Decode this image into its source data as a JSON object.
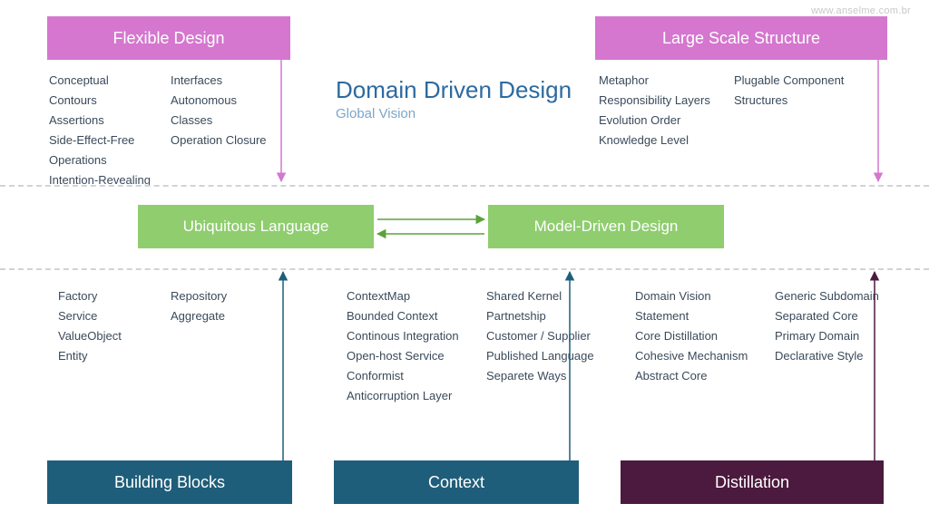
{
  "watermark": "www.anselme.com.br",
  "title": {
    "main": "Domain Driven Design",
    "sub": "Global Vision"
  },
  "top": {
    "flexible": {
      "header": "Flexible Design",
      "col1": [
        "Conceptual Contours",
        "Assertions",
        "Side-Effect-Free",
        "Operations",
        "Intention-Revealing"
      ],
      "col2": [
        "Interfaces",
        "Autonomous Classes",
        "Operation Closure"
      ]
    },
    "large": {
      "header": "Large Scale Structure",
      "col1": [
        "Metaphor",
        "Responsibility Layers",
        "Evolution Order",
        "Knowledge Level"
      ],
      "col2": [
        "Plugable Component",
        "Structures"
      ]
    }
  },
  "middle": {
    "left": "Ubiquitous Language",
    "right": "Model-Driven Design"
  },
  "bottom": {
    "building": {
      "header": "Building Blocks",
      "col1": [
        "Factory",
        "Service",
        "ValueObject",
        "Entity"
      ],
      "col2": [
        "Repository",
        "Aggregate"
      ]
    },
    "context": {
      "header": "Context",
      "col1": [
        "ContextMap",
        "Bounded Context",
        "Continous Integration",
        "Open-host Service",
        "Conformist",
        "Anticorruption Layer"
      ],
      "col2": [
        "Shared Kernel",
        "Partnetship",
        "Customer / Supplier",
        "Published Language",
        "Separete Ways"
      ]
    },
    "distillation": {
      "header": "Distillation",
      "col1": [
        "Domain Vision",
        "Statement",
        "Core Distillation",
        "Cohesive Mechanism",
        "Abstract Core"
      ],
      "col2": [
        "Generic Subdomain",
        "Separated Core",
        "Primary Domain",
        "Declarative Style"
      ]
    }
  },
  "colors": {
    "pink": "#d576cf",
    "green": "#8fcd6f",
    "blue": "#1f5e7a",
    "plum": "#4b1a3e"
  }
}
